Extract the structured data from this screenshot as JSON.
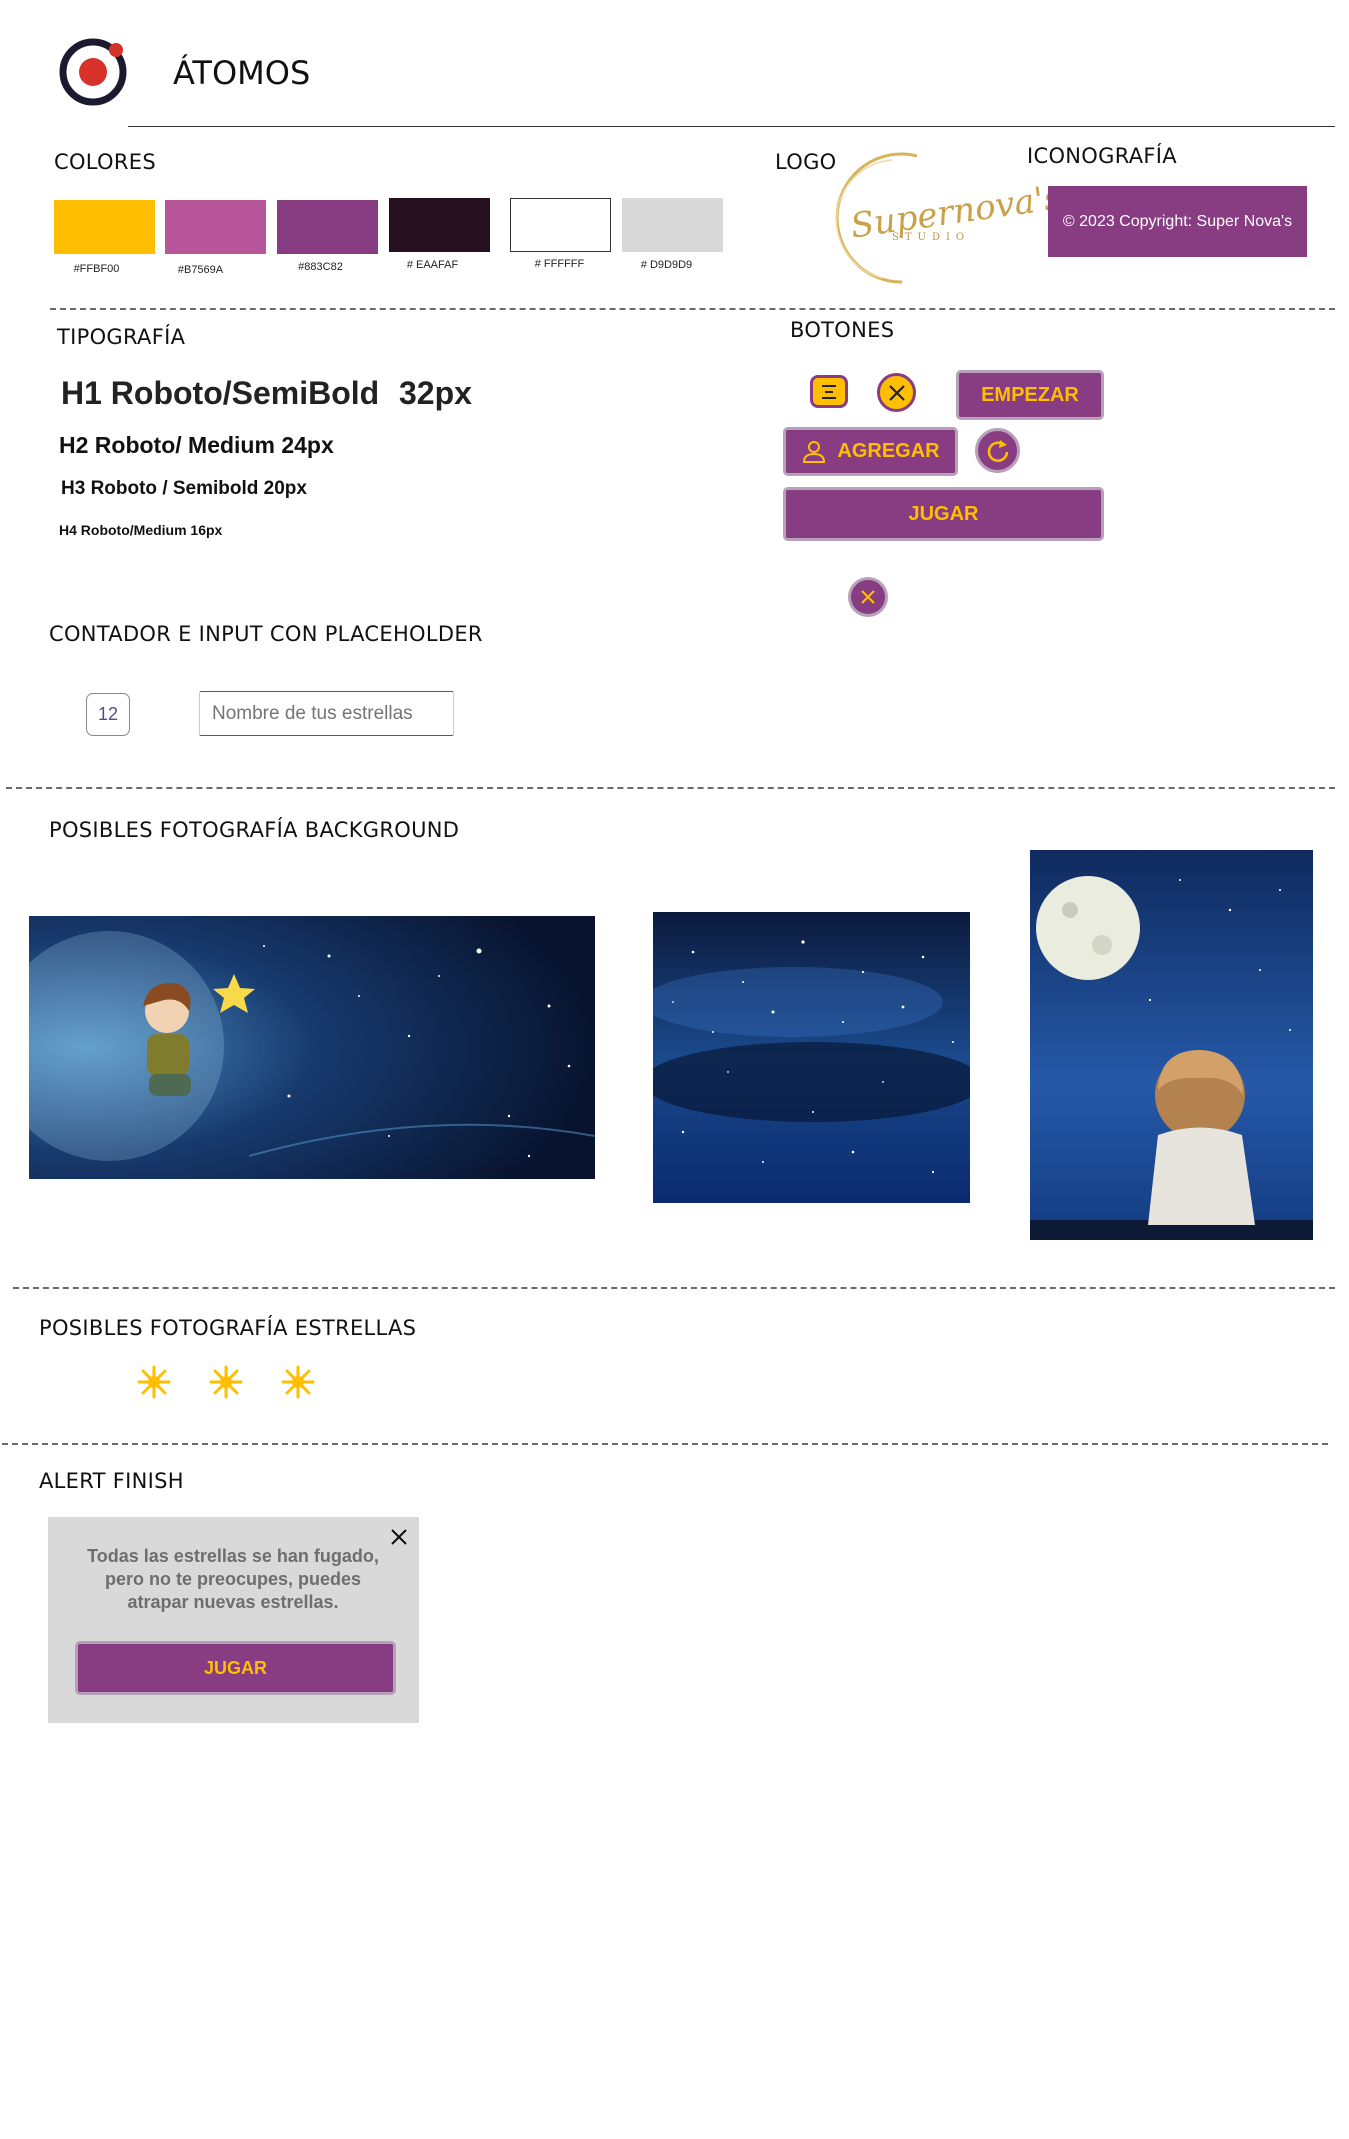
{
  "header": {
    "title": "ÁTOMOS"
  },
  "colors": {
    "title": "COLORES",
    "swatches": [
      {
        "hex": "#FFBF00",
        "label": "#FFBF00"
      },
      {
        "hex": "#B7569A",
        "label": "#B7569A"
      },
      {
        "hex": "#883C82",
        "label": "#883C82"
      },
      {
        "hex": "#26101F",
        "label": "# EAAFAF"
      },
      {
        "hex": "#FFFFFF",
        "label": "# FFFFFF"
      },
      {
        "hex": "#D9D9D9",
        "label": "# D9D9D9"
      }
    ]
  },
  "logo": {
    "title": "LOGO",
    "script_text": "Supernova's",
    "sub_text": "STUDIO"
  },
  "iconography": {
    "title": "ICONOGRAFÍA",
    "footer_text": "© 2023 Copyright: Super Nova's"
  },
  "typography": {
    "title": "TIPOGRAFÍA",
    "h1": "H1 Roboto/SemiBold",
    "h1_size": "32px",
    "h2": "H2 Roboto/ Medium 24px",
    "h3": "H3 Roboto / Semibold 20px",
    "h4": "H4 Roboto/Medium 16px"
  },
  "buttons": {
    "title": "BOTONES",
    "empezar": "EMPEZAR",
    "agregar": "AGREGAR",
    "jugar": "JUGAR"
  },
  "counter": {
    "title": "CONTADOR E INPUT CON PLACEHOLDER",
    "value": "12",
    "placeholder": "Nombre de tus estrellas"
  },
  "backgrounds": {
    "title": "POSIBLES FOTOGRAFÍA BACKGROUND"
  },
  "stars": {
    "title": "POSIBLES FOTOGRAFÍA ESTRELLAS"
  },
  "alert": {
    "title": "ALERT FINISH",
    "message": "Todas las estrellas se han fugado, pero no te preocupes, puedes atrapar nuevas estrellas.",
    "button": "JUGAR"
  }
}
